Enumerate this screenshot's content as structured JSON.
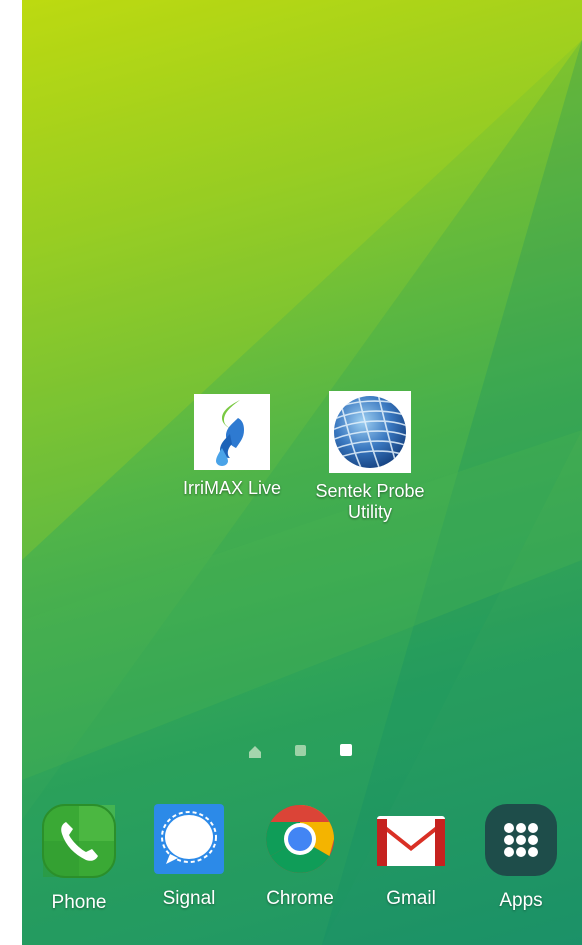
{
  "home": {
    "shortcuts": [
      {
        "label": "IrriMAX Live",
        "icon": "irrimax-live-icon"
      },
      {
        "label": "Sentek Probe\nUtility",
        "icon": "sentek-globe-icon"
      }
    ],
    "page_indicator": {
      "items": [
        "home",
        "page",
        "page"
      ],
      "current_index": 2
    }
  },
  "dock": {
    "apps": [
      {
        "label": "Phone",
        "icon": "phone-icon",
        "color": "#3aa935"
      },
      {
        "label": "Signal",
        "icon": "signal-icon",
        "color": "#2c8ae8"
      },
      {
        "label": "Chrome",
        "icon": "chrome-icon",
        "color": "#db4437"
      },
      {
        "label": "Gmail",
        "icon": "gmail-icon",
        "color": "#d93025"
      },
      {
        "label": "Apps",
        "icon": "apps-grid-icon",
        "color": "#1e4d4a"
      }
    ]
  },
  "colors": {
    "wallpaper_top": "#b8d812",
    "wallpaper_bottom": "#1f9468"
  }
}
